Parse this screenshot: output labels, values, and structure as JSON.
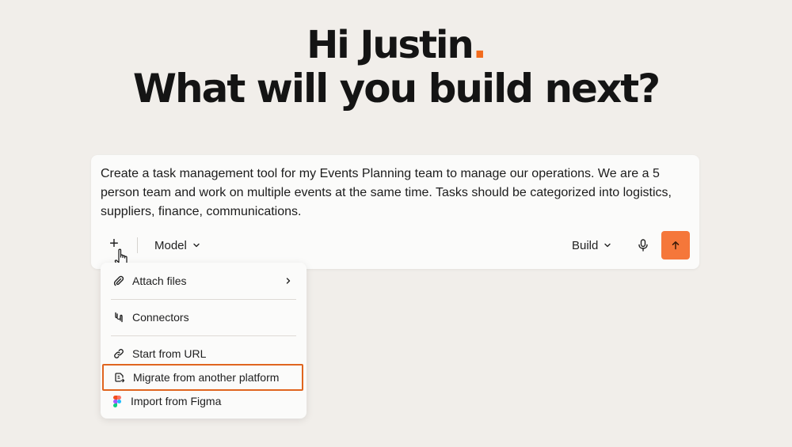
{
  "greeting": {
    "name_line": "Hi Justin",
    "name_dot": ".",
    "question": "What will you build next?"
  },
  "prompt": {
    "text": "Create a task management tool for my Events Planning team to manage our operations. We are a 5 person team and work on multiple events at the same time. Tasks should be categorized into logistics, suppliers, finance, communications."
  },
  "toolbar": {
    "plus_label": "+",
    "model_label": "Model",
    "build_label": "Build"
  },
  "menu": {
    "items": [
      {
        "label": "Attach files",
        "icon": "paperclip-icon",
        "has_submenu": true
      },
      {
        "label": "Connectors",
        "icon": "connectors-icon",
        "has_submenu": false
      },
      {
        "label": "Start from URL",
        "icon": "link-icon",
        "has_submenu": false
      },
      {
        "label": "Migrate from another platform",
        "icon": "migrate-icon",
        "has_submenu": false,
        "highlighted": true
      },
      {
        "label": "Import from Figma",
        "icon": "figma-icon",
        "has_submenu": false
      }
    ]
  },
  "colors": {
    "background": "#f1eeea",
    "accent": "#f26b1d",
    "send_button": "#f5773a",
    "highlight_border": "#e0651f"
  }
}
